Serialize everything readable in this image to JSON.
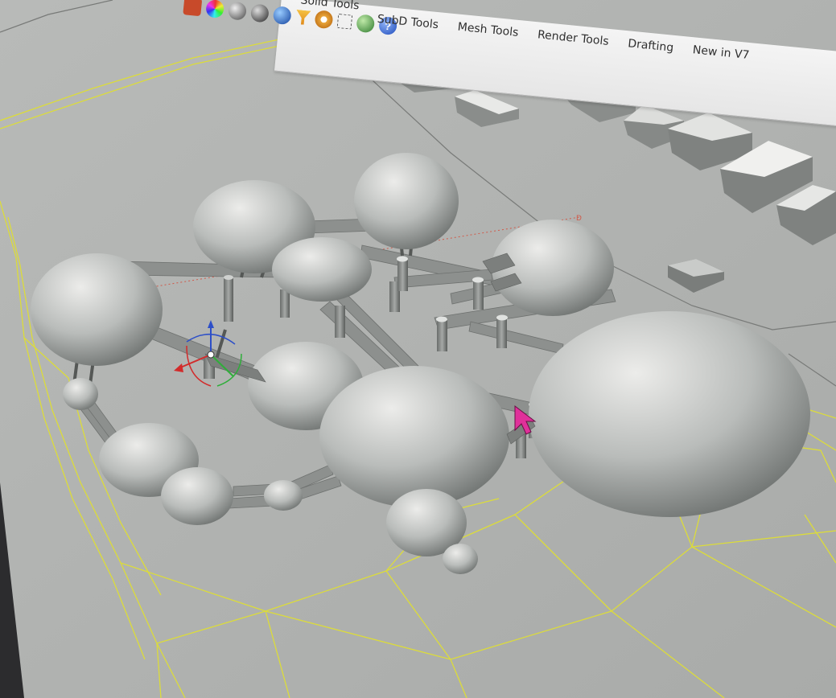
{
  "toolbar": {
    "tabs": [
      {
        "label": "Solid Tools"
      },
      {
        "label": "SubD Tools"
      },
      {
        "label": "Mesh Tools"
      },
      {
        "label": "Render Tools"
      },
      {
        "label": "Drafting"
      },
      {
        "label": "New in V7"
      }
    ],
    "icons": [
      "material-icon",
      "color-wheel-icon",
      "shade-sphere-icon",
      "shade-sphere-dark-icon",
      "render-sphere-icon",
      "filter-icon",
      "gear-icon",
      "grid-snap-icon",
      "render-globe-icon",
      "help-icon"
    ]
  },
  "viewport": {
    "view": "Perspective",
    "display_mode": "Shaded",
    "colors": {
      "background": "#b4b6b4",
      "mesh": "#dcdc3a",
      "object": "#9ea2a0",
      "cursor": "#e0309a"
    }
  }
}
